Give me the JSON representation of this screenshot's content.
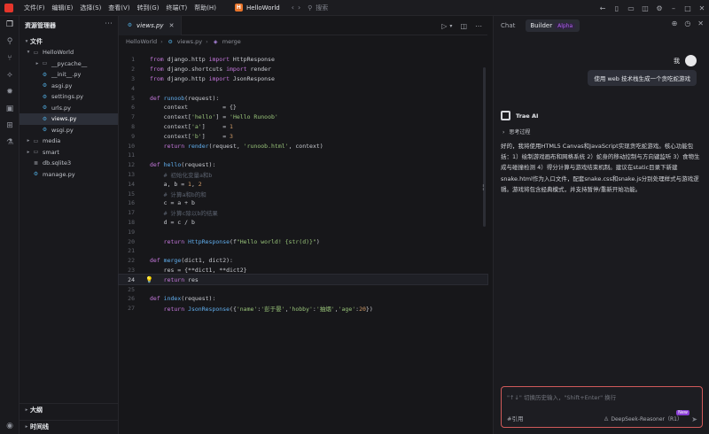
{
  "titlebar": {
    "menus": [
      "文件(F)",
      "编辑(E)",
      "选择(S)",
      "查看(V)",
      "转到(G)",
      "终端(T)",
      "帮助(H)"
    ],
    "project_badge": "H",
    "project_name": "HelloWorld",
    "search_placeholder": "搜索"
  },
  "explorer": {
    "title": "资源管理器",
    "section": "文件",
    "tree": [
      {
        "name": "HelloWorld",
        "type": "folder",
        "depth": 0,
        "expanded": true
      },
      {
        "name": "__pycache__",
        "type": "folder",
        "depth": 1,
        "expanded": false
      },
      {
        "name": "__init__.py",
        "type": "py",
        "depth": 1
      },
      {
        "name": "asgi.py",
        "type": "py",
        "depth": 1
      },
      {
        "name": "settings.py",
        "type": "py",
        "depth": 1
      },
      {
        "name": "urls.py",
        "type": "py",
        "depth": 1
      },
      {
        "name": "views.py",
        "type": "py",
        "depth": 1,
        "selected": true
      },
      {
        "name": "wsgi.py",
        "type": "py",
        "depth": 1
      },
      {
        "name": "media",
        "type": "folder",
        "depth": 0,
        "expanded": false
      },
      {
        "name": "smart",
        "type": "folder",
        "depth": 0,
        "expanded": false
      },
      {
        "name": "db.sqlite3",
        "type": "db",
        "depth": 0
      },
      {
        "name": "manage.py",
        "type": "py",
        "depth": 0
      }
    ],
    "outline": "大纲",
    "timeline": "时间线"
  },
  "editor": {
    "tab_label": "views.py",
    "breadcrumb": [
      "HelloWorld",
      "views.py",
      "merge"
    ],
    "current_line": 24,
    "lines": [
      "from django.http import HttpResponse",
      "from django.shortcuts import render",
      "from django.http import JsonResponse",
      "",
      "def runoob(request):",
      "    context          = {}",
      "    context['hello'] = 'Hello Runoob'",
      "    context['a']     = 1",
      "    context['b']     = 3",
      "    return render(request, 'runoob.html', context)",
      "",
      "def hello(request):",
      "    # 初始化变量a和b",
      "    a, b = 1, 2",
      "    # 计算a和b的和",
      "    c = a + b",
      "    # 计算c除以b的结果",
      "    d = c / b",
      "",
      "    return HttpResponse(f\"Hello world! {str(d)}\")",
      "",
      "def merge(dict1, dict2):",
      "    res = {**dict1, **dict2}",
      "    return res",
      "",
      "def index(request):",
      "    return JsonResponse({'name':'彭于晏','hobby':'抽烟','age':20})"
    ]
  },
  "chat": {
    "tab_chat": "Chat",
    "tab_builder": "Builder",
    "alpha_label": "Alpha",
    "user_name": "我",
    "user_message": "使用 web 技术栈生成一个贪吃蛇游戏",
    "ai_name": "Trae AI",
    "thinking_label": "思考过程",
    "ai_response": "好的，我将使用HTML5 Canvas和JavaScript实现贪吃蛇游戏。核心功能包括：1）绘制游戏画布和网格系统 2）蛇身的移动控制与方向键监听 3）食物生成与碰撞检测 4）得分计算与游戏结束机制。建议在static目录下新建snake.html作为入口文件，配套snake.css和snake.js分别处理样式与游戏逻辑。游戏将包含经典模式，并支持暂停/重新开始功能。",
    "input_placeholder": "\"↑↓\" 切换历史输入，\"Shift+Enter\" 换行",
    "ref_label": "#引用",
    "model_label": "DeepSeek-Reasoner（R1）",
    "new_badge": "New"
  }
}
